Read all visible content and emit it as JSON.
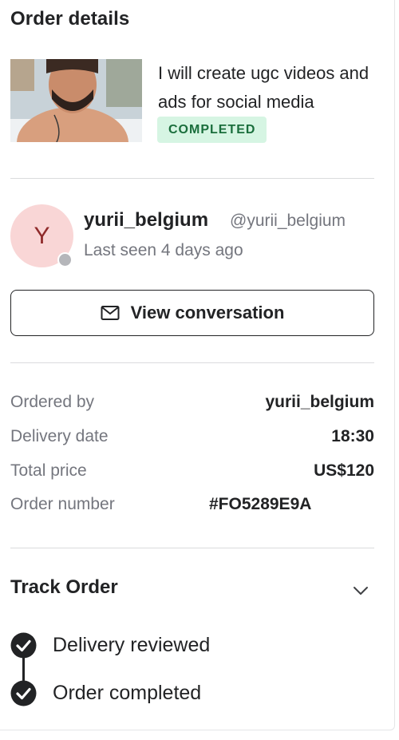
{
  "order": {
    "title": "Order details",
    "gig_title": "I will create ugc videos and ads for social media",
    "status_badge": "COMPLETED"
  },
  "seller": {
    "avatar_letter": "Y",
    "username": "yurii_belgium",
    "handle": "@yurii_belgium",
    "last_seen": "Last seen 4 days ago"
  },
  "actions": {
    "view_conversation": "View conversation"
  },
  "details": [
    {
      "label": "Ordered by",
      "value": "yurii_belgium"
    },
    {
      "label": "Delivery date",
      "value": "18:30"
    },
    {
      "label": "Total price",
      "value": "US$120"
    },
    {
      "label": "Order number",
      "value": "#FO5289E9A"
    }
  ],
  "tracking": {
    "title": "Track Order",
    "steps": [
      {
        "label": "Delivery reviewed"
      },
      {
        "label": "Order completed"
      }
    ]
  },
  "colors": {
    "badge_bg": "#d6f5e3",
    "badge_text": "#1a6e3c",
    "avatar_bg": "#f9d6d6",
    "avatar_text": "#8f2a2a"
  },
  "icons": {
    "button": "envelope-icon",
    "collapse": "chevron-down-icon",
    "step": "check-circle-icon"
  }
}
